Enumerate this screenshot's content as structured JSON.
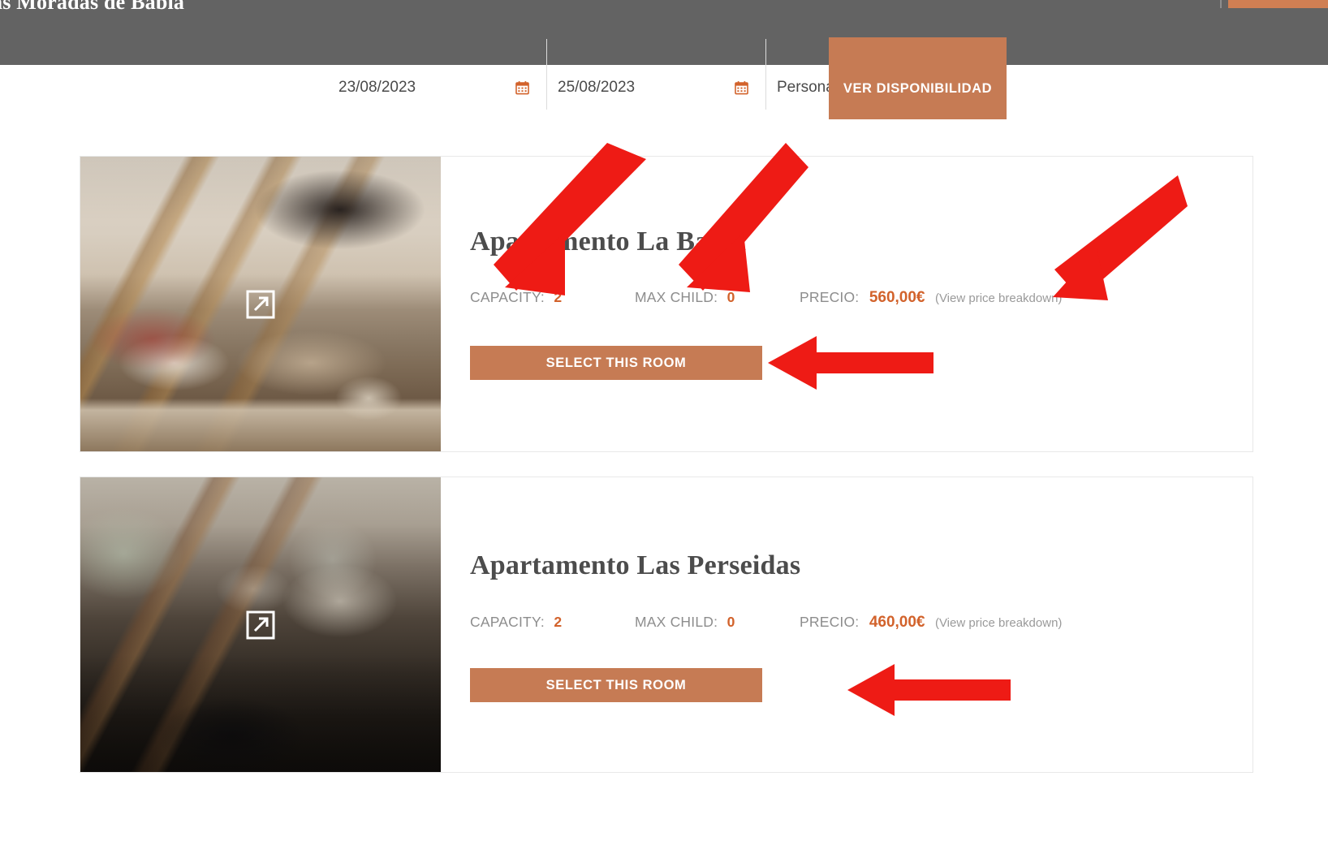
{
  "header": {
    "site_title": "as Moradas de Babia",
    "accent_color": "#d07f53",
    "background_color": "#636363"
  },
  "booking_bar": {
    "check_in": {
      "value": "23/08/2023",
      "icon": "calendar-icon"
    },
    "check_out": {
      "value": "25/08/2023",
      "icon": "calendar-icon"
    },
    "guests": {
      "label": "Persona",
      "icon": "chevron-down-icon"
    },
    "availability_button": "VER DISPONIBILIDAD",
    "button_color": "#c67b54"
  },
  "rooms": [
    {
      "title": "Apartamento La Babia",
      "capacity_label": "CAPACITY:",
      "capacity_value": "2",
      "max_child_label": "MAX CHILD:",
      "max_child_value": "0",
      "price_label": "PRECIO:",
      "price_value": "560,00€",
      "price_breakdown": "(View price breakdown)",
      "select_button": "SELECT THIS ROOM",
      "expand_icon": "expand-icon"
    },
    {
      "title": "Apartamento Las Perseidas",
      "capacity_label": "CAPACITY:",
      "capacity_value": "2",
      "max_child_label": "MAX CHILD:",
      "max_child_value": "0",
      "price_label": "PRECIO:",
      "price_value": "460,00€",
      "price_breakdown": "(View price breakdown)",
      "select_button": "SELECT THIS ROOM",
      "expand_icon": "expand-icon"
    }
  ],
  "annotations": {
    "arrow_color": "#ee1b15",
    "count": 5
  }
}
